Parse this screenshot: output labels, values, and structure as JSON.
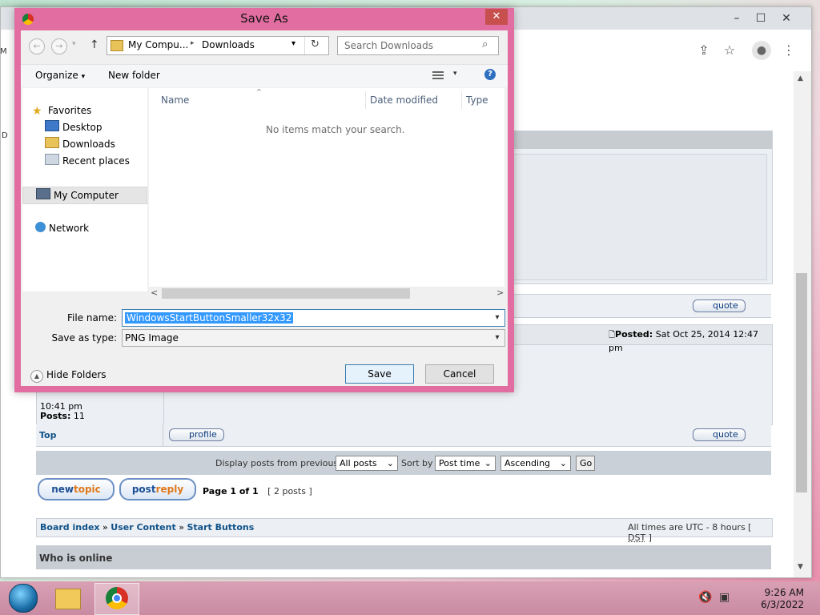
{
  "browser": {
    "controls": {
      "minimize": "–",
      "maximize": "☐",
      "close": "✕"
    },
    "toolbar_icons": {
      "share": "⇪",
      "bookmark": "☆",
      "profile": "●",
      "menu": "⋮"
    },
    "scroll_up": "▲",
    "scroll_down": "▼",
    "edge_letters": [
      "M",
      "D"
    ]
  },
  "forum": {
    "post_date_label": "Posted:",
    "post_date_value": "Sat Oct 25, 2014 12:47 pm",
    "quote_label": "quote",
    "profile_label": "profile",
    "author_time": "10:41 pm",
    "author_posts_label": "Posts:",
    "author_posts_value": "11",
    "top_link": "Top",
    "display_label": "Display posts from previous:",
    "display_value": "All posts",
    "sort_label": "Sort by",
    "sort_value": "Post time",
    "order_value": "Ascending",
    "go_label": "Go",
    "newtopic_a": "new",
    "newtopic_b": "topic",
    "postreply_a": "post",
    "postreply_b": "reply",
    "page_label": "Page 1 of 1",
    "post_count": "[ 2 posts ]",
    "breadcrumb": [
      "Board index",
      "User Content",
      "Start Buttons"
    ],
    "breadcrumb_sep": "»",
    "times_text": "All times are UTC - 8 hours [",
    "dst": "DST",
    "times_close": "]",
    "who_online": "Who is online"
  },
  "dialog": {
    "title": "Save As",
    "close": "✕",
    "back": "←",
    "forward": "→",
    "recent": "▾",
    "up": "↑",
    "address": [
      "My Compu...",
      "Downloads"
    ],
    "address_sep": "▸",
    "address_dropdown": "▾",
    "refresh": "↻",
    "search_placeholder": "Search Downloads",
    "organize": "Organize",
    "organize_arrow": "▾",
    "new_folder": "New folder",
    "view_arrow": "▾",
    "help": "?",
    "nav": {
      "favorites": "Favorites",
      "desktop": "Desktop",
      "downloads": "Downloads",
      "recent_places": "Recent places",
      "my_computer": "My Computer",
      "network": "Network"
    },
    "columns": {
      "name": "Name",
      "date_modified": "Date modified",
      "type": "Type",
      "sort_indicator": "^"
    },
    "empty_message": "No items match your search.",
    "hscroll_left": "<",
    "hscroll_right": ">",
    "file_name_label": "File name:",
    "file_name_value": "WindowsStartButtonSmaller32x32",
    "save_type_label": "Save as type:",
    "save_type_value": "PNG Image",
    "combo_arrow": "▾",
    "hide_folders": "Hide Folders",
    "hide_folders_icon": "▲",
    "save": "Save",
    "cancel": "Cancel"
  },
  "taskbar": {
    "time": "9:26 AM",
    "date": "6/3/2022",
    "volume_icon": "🔇",
    "network_icon": "▣"
  }
}
